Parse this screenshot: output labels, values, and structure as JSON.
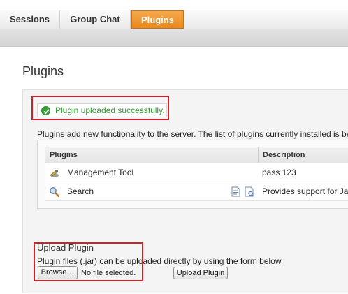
{
  "tabs": [
    {
      "label": "Sessions"
    },
    {
      "label": "Group Chat"
    },
    {
      "label": "Plugins",
      "active": true
    }
  ],
  "page": {
    "title": "Plugins"
  },
  "success": {
    "message": "Plugin uploaded successfully."
  },
  "intro": "Plugins add new functionality to the server. The list of plugins currently installed is be",
  "table": {
    "columns": [
      "Plugins",
      "Description"
    ],
    "rows": [
      {
        "name": "Management Tool",
        "description": "pass 123",
        "icon": "tools-icon"
      },
      {
        "name": "Search",
        "description": "Provides support for Ja",
        "icon": "search-icon"
      }
    ]
  },
  "upload": {
    "title": "Upload Plugin",
    "description": "Plugin files (.jar) can be uploaded directly by using the form below.",
    "browse_label": "Browse…",
    "file_status": "No file selected.",
    "submit_label": "Upload Plugin"
  },
  "colors": {
    "active_tab": "#ec9430",
    "success_text": "#2c9a2c",
    "highlight": "#d0202a"
  }
}
